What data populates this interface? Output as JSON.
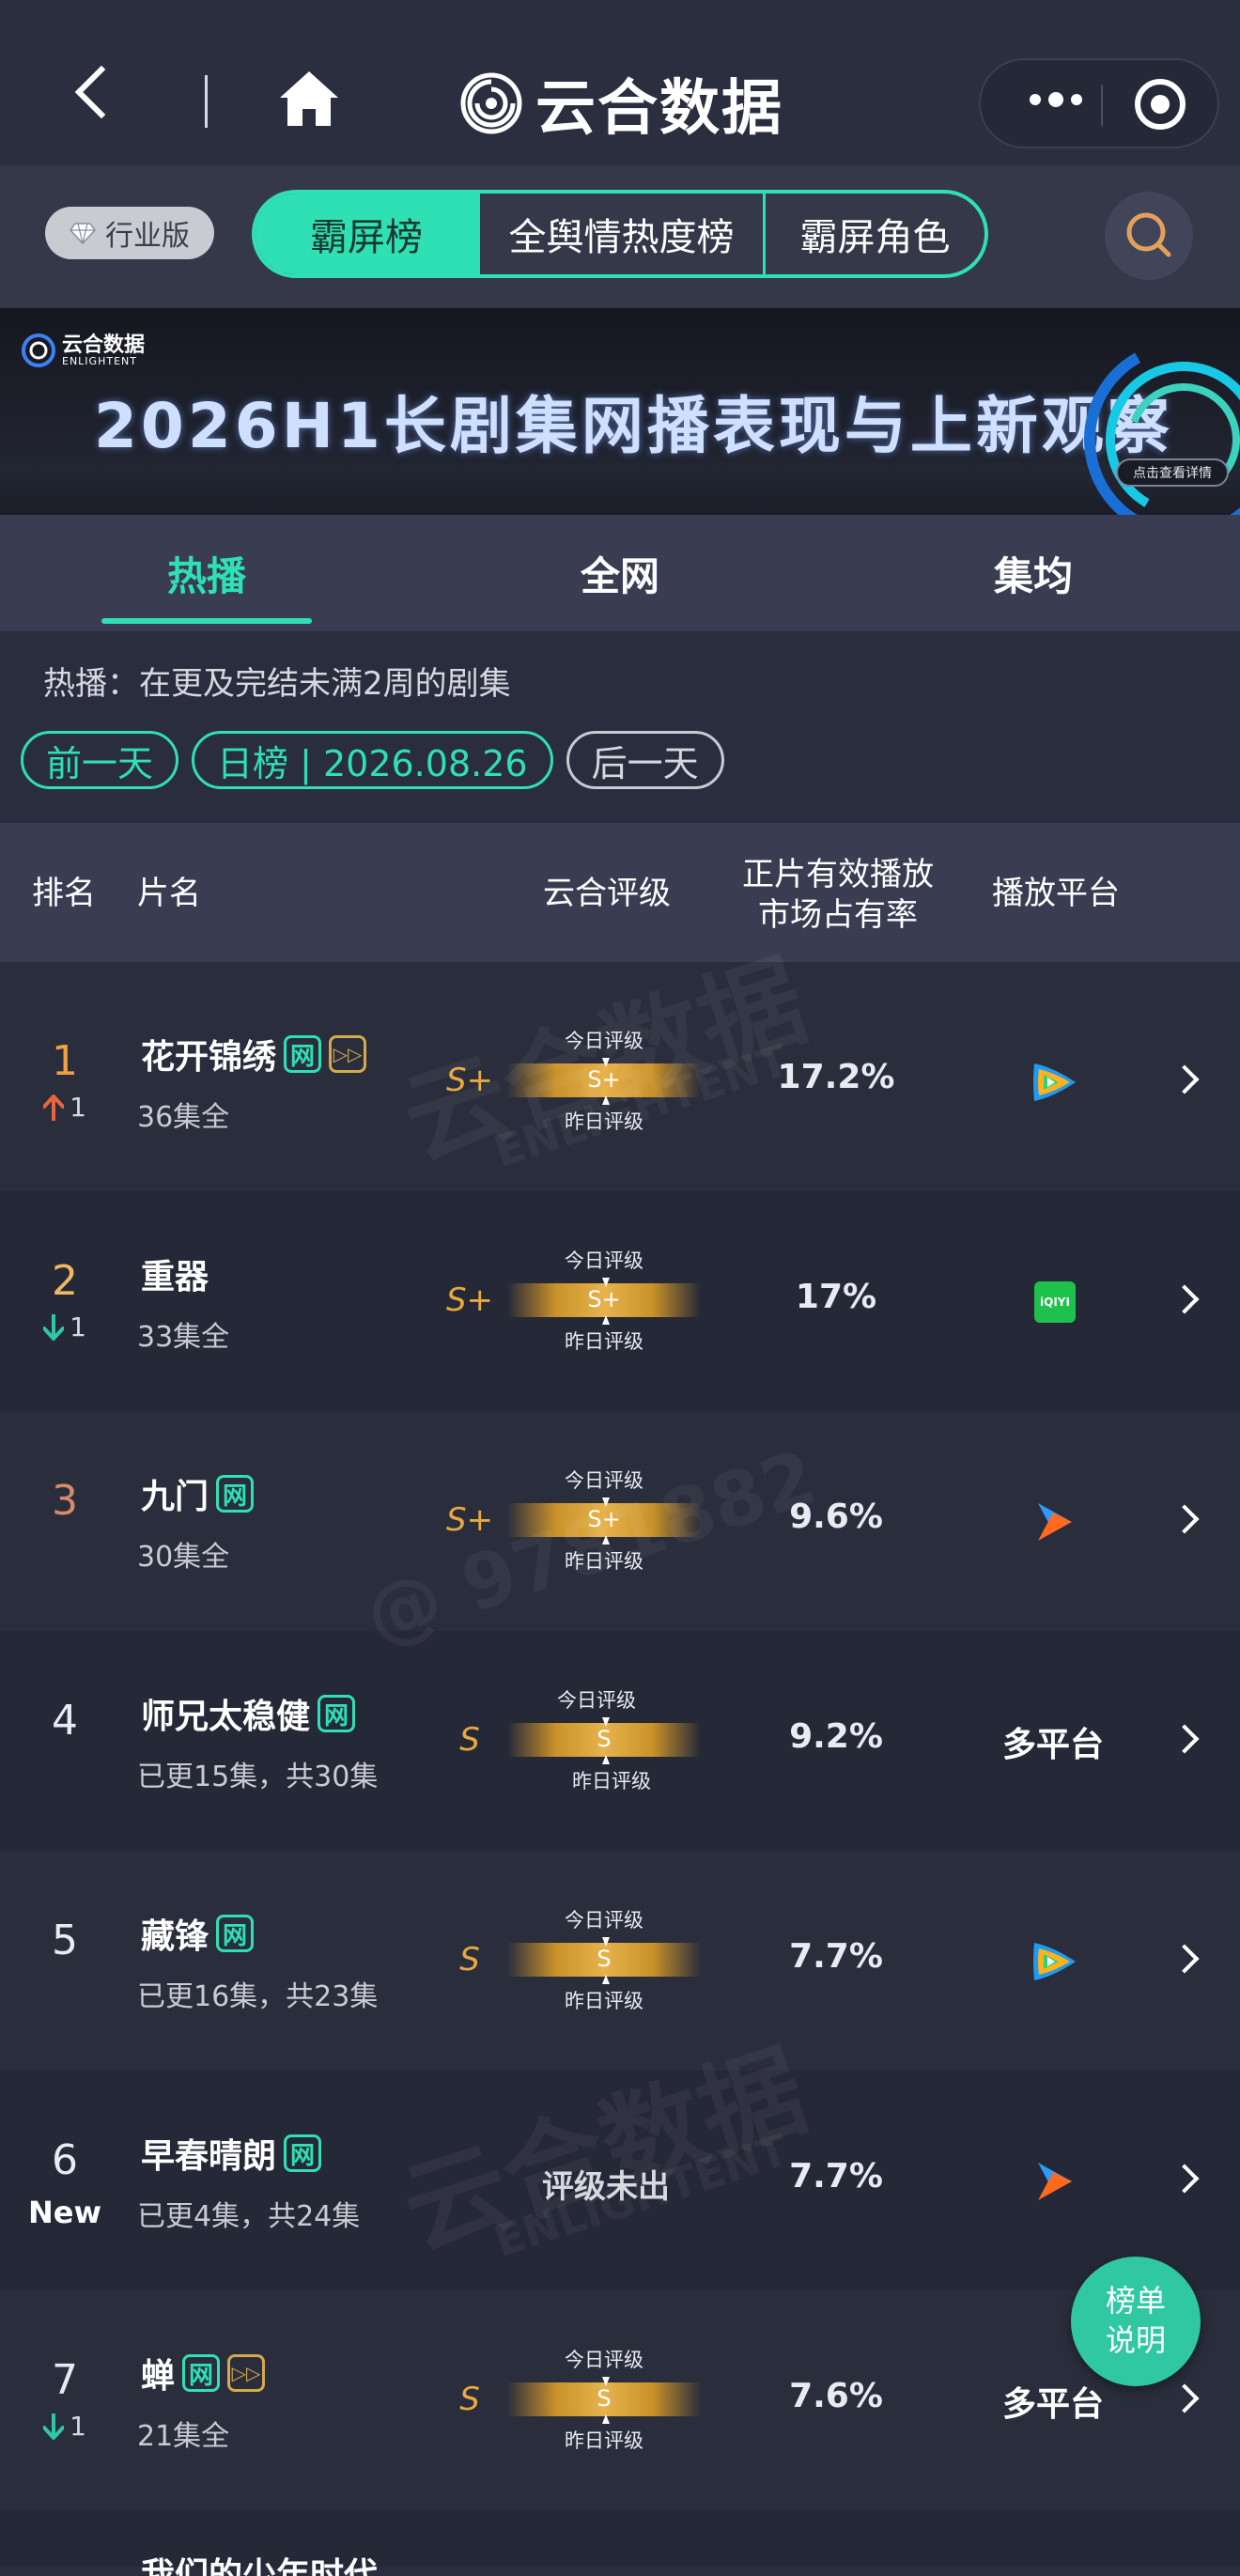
{
  "nav": {
    "brand_name": "云合数据"
  },
  "toolbar": {
    "edition_label": "行业版",
    "segments": [
      "霸屏榜",
      "全舆情热度榜",
      "霸屏角色"
    ]
  },
  "banner": {
    "logo_cn": "云合数据",
    "logo_en": "ENLIGHTENT",
    "title": "2026H1长剧集网播表现与上新观察",
    "cta": "点击查看详情"
  },
  "subtabs": [
    "热播",
    "全网",
    "集均"
  ],
  "description": "热播：在更及完结未满2周的剧集",
  "datenav": {
    "prev": "前一天",
    "current": "日榜 | 2026.08.26",
    "next": "后一天"
  },
  "table_header": {
    "rank": "排名",
    "title": "片名",
    "grade": "云合评级",
    "share_line1": "正片有效播放",
    "share_line2": "市场占有率",
    "platform": "播放平台"
  },
  "bar_labels": {
    "today": "今日评级",
    "yesterday": "昨日评级"
  },
  "rows": [
    {
      "rank": "1",
      "change": "1",
      "title": "花开锦绣",
      "episodes": "36集全",
      "grade": "S+",
      "grade_bar": "S+",
      "share": "17.2%"
    },
    {
      "rank": "2",
      "change": "1",
      "title": "重器",
      "episodes": "33集全",
      "grade": "S+",
      "grade_bar": "S+",
      "share": "17%",
      "platform_badge": "iQIYI"
    },
    {
      "rank": "3",
      "title": "九门",
      "episodes": "30集全",
      "grade": "S+",
      "grade_bar": "S+",
      "share": "9.6%"
    },
    {
      "rank": "4",
      "title": "师兄太稳健",
      "episodes": "已更15集，共30集",
      "grade": "S",
      "grade_bar": "S",
      "share": "9.2%",
      "platform_text": "多平台"
    },
    {
      "rank": "5",
      "title": "藏锋",
      "episodes": "已更16集，共23集",
      "grade": "S",
      "grade_bar": "S",
      "share": "7.7%"
    },
    {
      "rank": "6",
      "new": "New",
      "title": "早春晴朗",
      "episodes": "已更4集，共24集",
      "no_grade": "评级未出",
      "share": "7.7%"
    },
    {
      "rank": "7",
      "change": "1",
      "title": "蝉",
      "episodes": "21集全",
      "grade": "S",
      "grade_bar": "S",
      "share": "7.6%",
      "platform_text": "多平台"
    }
  ],
  "badges": {
    "net": "网"
  },
  "partial_row_title": "我们的少年时代",
  "help_button": {
    "line1": "榜单",
    "line2": "说明"
  },
  "watermarks": [
    "云合数据",
    "ENLIGHTENT",
    "@ 9781882"
  ],
  "colors": {
    "accent": "#2fe0b4",
    "gold": "#e7a93f",
    "rank_top": "#f0a040",
    "up": "#e9653f",
    "down": "#2fc8a3"
  }
}
